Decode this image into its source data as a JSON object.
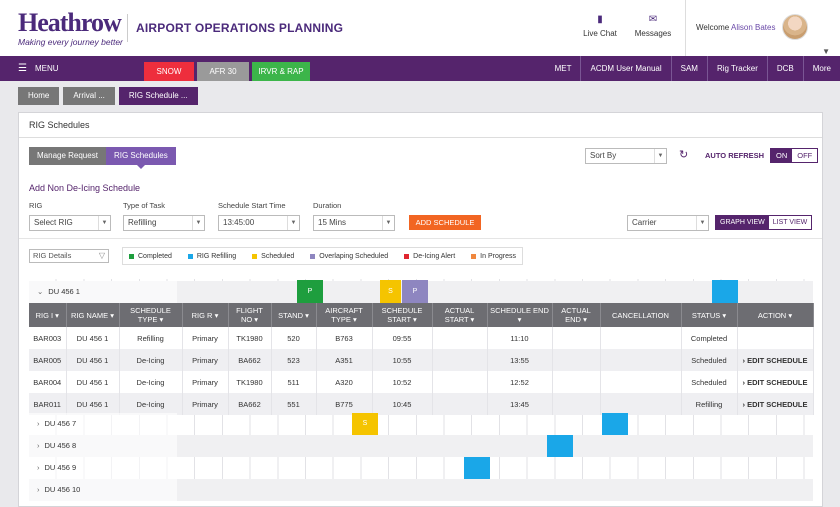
{
  "header": {
    "logo_word": "Heathrow",
    "logo_tagline": "Making every journey better",
    "app_title": "AIRPORT OPERATIONS PLANNING",
    "live_chat": "Live Chat",
    "messages": "Messages",
    "welcome_prefix": "Welcome",
    "user_name": "Alison Bates"
  },
  "nav": {
    "menu_label": "MENU",
    "alerts": [
      {
        "label": "SNOW",
        "color": "#ee2e3d"
      },
      {
        "label": "AFR 30",
        "color": "#9a9a9a"
      },
      {
        "label": "IRVR & RAP",
        "color": "#3cb54a"
      }
    ],
    "links": [
      "MET",
      "ACDM User Manual",
      "SAM",
      "Rig Tracker",
      "DCB",
      "More"
    ]
  },
  "breadcrumbs": [
    "Home",
    "Arrival ...",
    "RIG Schedule ..."
  ],
  "panel": {
    "title": "RIG Schedules",
    "tabs": [
      "Manage Request",
      "RIG Schedules"
    ],
    "sort_by": "Sort By",
    "auto_refresh": "AUTO REFRESH",
    "toggle_on": "ON",
    "toggle_off": "OFF"
  },
  "form": {
    "title": "Add Non De-Icing Schedule",
    "rig_label": "RIG",
    "rig_value": "Select RIG",
    "task_label": "Type of Task",
    "task_value": "Refilling",
    "start_label": "Schedule Start Time",
    "start_value": "13:45:00",
    "duration_label": "Duration",
    "duration_value": "15 Mins",
    "add_button": "ADD SCHEDULE",
    "carrier_value": "Carrier",
    "graph_view": "GRAPH VIEW",
    "list_view": "LIST VIEW"
  },
  "filter": {
    "rig_details": "RIG Details"
  },
  "legend": [
    {
      "label": "Completed",
      "color": "#1e9e3e"
    },
    {
      "label": "RIG Refilling",
      "color": "#1aa7e8"
    },
    {
      "label": "Scheduled",
      "color": "#f5c400"
    },
    {
      "label": "Overlaping Scheduled",
      "color": "#8e86c0"
    },
    {
      "label": "De-Icing Alert",
      "color": "#e0262f"
    },
    {
      "label": "In Progress",
      "color": "#f0873e"
    }
  ],
  "groups": {
    "g1": "DU 456 1",
    "g1_markers": [
      "P",
      "S",
      "P"
    ],
    "g7": "DU 456 7",
    "g7_marker": "S",
    "g8": "DU 456 8",
    "g9": "DU 456 9",
    "g10": "DU 456 10"
  },
  "table": {
    "headers": [
      "RIG I",
      "RIG NAME",
      "SCHEDULE TYPE",
      "RIG R",
      "FLIGHT NO",
      "STAND",
      "AIRCRAFT TYPE",
      "SCHEDULE START",
      "ACTUAL START",
      "SCHEDULE END",
      "ACTUAL END",
      "CANCELLATION",
      "STATUS",
      "ACTION"
    ],
    "rows": [
      {
        "rig_id": "BAR003",
        "rig_name": "DU 456 1",
        "type": "Refilling",
        "role": "Primary",
        "flight": "TK1980",
        "stand": "520",
        "aircraft": "B763",
        "sched_start": "09:55",
        "actual_start": "",
        "sched_end": "11:10",
        "actual_end": "",
        "cancel": "",
        "status": "Completed",
        "action": ""
      },
      {
        "rig_id": "BAR005",
        "rig_name": "DU 456 1",
        "type": "De-Icing",
        "role": "Primary",
        "flight": "BA662",
        "stand": "523",
        "aircraft": "A351",
        "sched_start": "10:55",
        "actual_start": "",
        "sched_end": "13:55",
        "actual_end": "",
        "cancel": "",
        "status": "Scheduled",
        "action": "EDIT SCHEDULE"
      },
      {
        "rig_id": "BAR004",
        "rig_name": "DU 456 1",
        "type": "De-Icing",
        "role": "Primary",
        "flight": "TK1980",
        "stand": "511",
        "aircraft": "A320",
        "sched_start": "10:52",
        "actual_start": "",
        "sched_end": "12:52",
        "actual_end": "",
        "cancel": "",
        "status": "Scheduled",
        "action": "EDIT SCHEDULE"
      },
      {
        "rig_id": "BAR011",
        "rig_name": "DU 456 1",
        "type": "De-Icing",
        "role": "Primary",
        "flight": "BA662",
        "stand": "551",
        "aircraft": "B775",
        "sched_start": "10:45",
        "actual_start": "",
        "sched_end": "13:45",
        "actual_end": "",
        "cancel": "",
        "status": "Refilling",
        "action": "EDIT SCHEDULE"
      }
    ]
  }
}
